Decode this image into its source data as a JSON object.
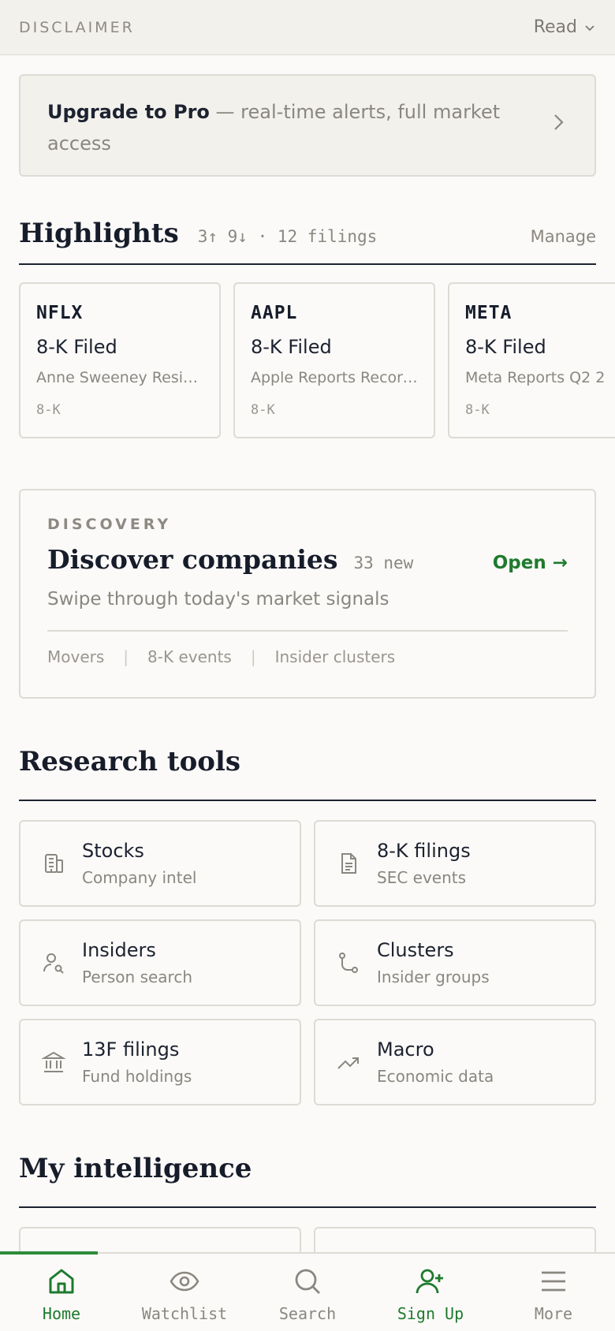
{
  "topbar": {
    "disclaimer": "DISCLAIMER",
    "read": "Read"
  },
  "upgrade": {
    "title": "Upgrade to Pro",
    "rest": " — real-time alerts, full market access"
  },
  "highlights": {
    "title": "Highlights",
    "meta": "3↑ 9↓ · 12 filings",
    "manage": "Manage",
    "cards": [
      {
        "ticker": "NFLX",
        "event": "8-K Filed",
        "desc": "Anne Sweeney Resig...",
        "tag": "8-K"
      },
      {
        "ticker": "AAPL",
        "event": "8-K Filed",
        "desc": "Apple Reports Record...",
        "tag": "8-K"
      },
      {
        "ticker": "META",
        "event": "8-K Filed",
        "desc": "Meta Reports Q2 2",
        "tag": "8-K"
      }
    ]
  },
  "discovery": {
    "eyebrow": "DISCOVERY",
    "title": "Discover companies",
    "new": "33 new",
    "open": "Open →",
    "subtitle": "Swipe through today's market signals",
    "chips": [
      "Movers",
      "8-K events",
      "Insider clusters"
    ]
  },
  "research": {
    "title": "Research tools",
    "tools": [
      {
        "title": "Stocks",
        "sub": "Company intel",
        "icon": "building-icon"
      },
      {
        "title": "8-K filings",
        "sub": "SEC events",
        "icon": "document-icon"
      },
      {
        "title": "Insiders",
        "sub": "Person search",
        "icon": "person-search-icon"
      },
      {
        "title": "Clusters",
        "sub": "Insider groups",
        "icon": "branch-icon"
      },
      {
        "title": "13F filings",
        "sub": "Fund holdings",
        "icon": "bank-icon"
      },
      {
        "title": "Macro",
        "sub": "Economic data",
        "icon": "trend-up-icon"
      }
    ]
  },
  "intelligence": {
    "title": "My intelligence"
  },
  "nav": [
    {
      "label": "Home",
      "icon": "home-icon",
      "active": true
    },
    {
      "label": "Watchlist",
      "icon": "eye-icon"
    },
    {
      "label": "Search",
      "icon": "search-icon"
    },
    {
      "label": "Sign Up",
      "icon": "user-plus-icon"
    },
    {
      "label": "More",
      "icon": "menu-icon"
    }
  ],
  "colors": {
    "accent": "#1f7a2e",
    "ink": "#161c2a",
    "muted": "#8a8780",
    "border": "#dedbd4",
    "bg": "#fbfaf8"
  }
}
